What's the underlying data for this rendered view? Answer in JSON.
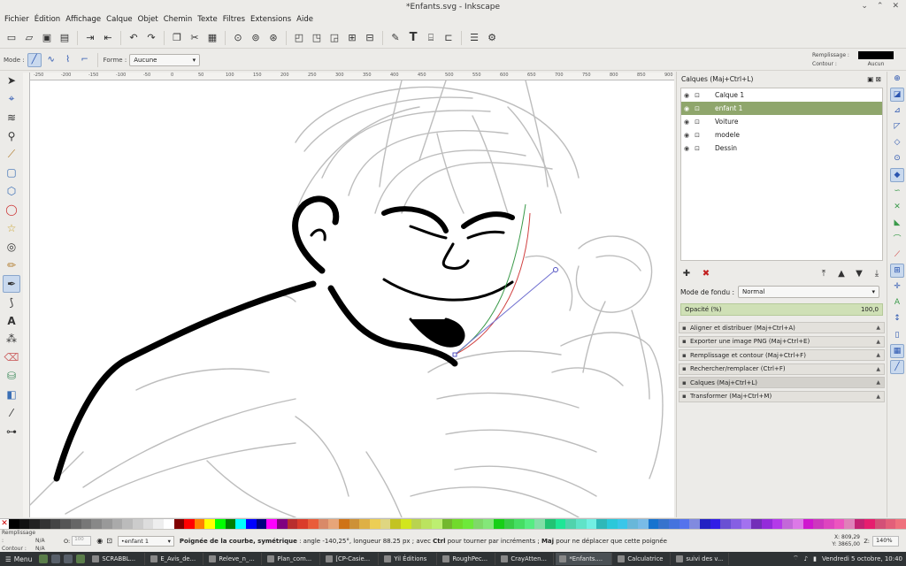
{
  "window": {
    "title": "*Enfants.svg - Inkscape",
    "buttons": [
      "⌄",
      "⌃",
      "✕"
    ]
  },
  "menu": [
    "Fichier",
    "Édition",
    "Affichage",
    "Calque",
    "Objet",
    "Chemin",
    "Texte",
    "Filtres",
    "Extensions",
    "Aide"
  ],
  "controls": {
    "mode_label": "Mode :",
    "forme_label": "Forme :",
    "forme_value": "Aucune",
    "fill_label": "Remplissage :",
    "stroke_label": "Contour :",
    "stroke_value": "Aucun"
  },
  "ruler": {
    "ticks": [
      "-250",
      "-200",
      "-150",
      "-100",
      "-50",
      "0",
      "50",
      "100",
      "150",
      "200",
      "250",
      "300",
      "350",
      "400",
      "450",
      "500",
      "550",
      "600",
      "650",
      "700",
      "750",
      "800",
      "850",
      "900"
    ]
  },
  "layers_panel": {
    "title": "Calques (Maj+Ctrl+L)",
    "layers": [
      {
        "name": "Calque 1",
        "selected": false
      },
      {
        "name": "enfant 1",
        "selected": true
      },
      {
        "name": "Voiture",
        "selected": false
      },
      {
        "name": "modele",
        "selected": false
      },
      {
        "name": "Dessin",
        "selected": false
      }
    ],
    "blend_label": "Mode de fondu :",
    "blend_value": "Normal",
    "opacity_label": "Opacité (%)",
    "opacity_value": "100,0"
  },
  "docks": [
    {
      "label": "Aligner et distribuer (Maj+Ctrl+A)",
      "icon": "align-icon"
    },
    {
      "label": "Exporter une image PNG (Maj+Ctrl+E)",
      "icon": "export-icon"
    },
    {
      "label": "Remplissage et contour (Maj+Ctrl+F)",
      "icon": "fill-stroke-icon"
    },
    {
      "label": "Rechercher/remplacer (Ctrl+F)",
      "icon": "search-icon"
    },
    {
      "label": "Calques (Maj+Ctrl+L)",
      "icon": "layers-icon"
    },
    {
      "label": "Transformer (Maj+Ctrl+M)",
      "icon": "transform-icon"
    }
  ],
  "status": {
    "fill_label": "Remplissage :",
    "fill_value": "N/A",
    "stroke_label": "Contour :",
    "stroke_value": "N/A",
    "o_label": "O:",
    "o_value": "100",
    "layer_value": "•enfant 1",
    "message_bold": "Poignée de la courbe, symétrique",
    "message_rest": " : angle -140,25°, longueur 88.25 px ; avec ",
    "message_ctrl": "Ctrl",
    "message_rest2": " pour tourner par incréments ; ",
    "message_maj": "Maj",
    "message_rest3": " pour ne déplacer que cette poignée",
    "x_label": "X:",
    "x_value": "809,29",
    "y_label": "Y:",
    "y_value": "3865,00",
    "z_label": "Z:",
    "zoom_value": "140%"
  },
  "taskbar": {
    "start": "Menu",
    "tasks": [
      "SCRABBL...",
      "E_Avis_de...",
      "Releve_n_...",
      "Plan_com...",
      "[CP-Casie...",
      "Yil Éditions",
      "RoughPec...",
      "CrayAtten...",
      "*Enfants....",
      "Calculatrice",
      "suivi des v..."
    ],
    "clock": "Vendredi  5 octobre, 10:40"
  },
  "colors": {
    "accent": "#8fa66c",
    "opacity_bg": "#cfe0b6"
  }
}
